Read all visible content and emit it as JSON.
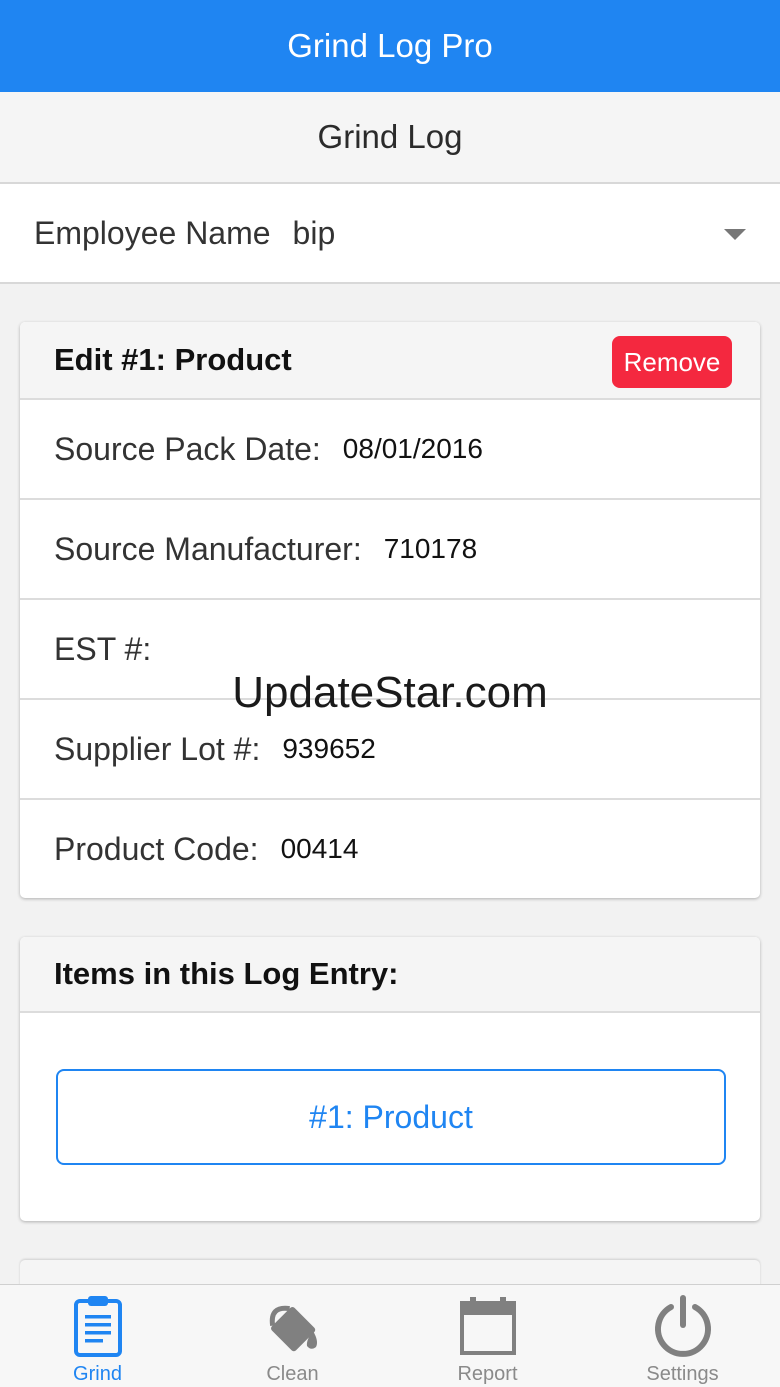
{
  "app_bar": {
    "title": "Grind Log Pro"
  },
  "page_header": {
    "title": "Grind Log"
  },
  "employee": {
    "label": "Employee Name",
    "value": "bip"
  },
  "edit_card": {
    "title": "Edit #1: Product",
    "remove_label": "Remove",
    "fields": [
      {
        "label": "Source Pack Date:",
        "value": "08/01/2016"
      },
      {
        "label": "Source Manufacturer:",
        "value": "710178"
      },
      {
        "label": "EST #:",
        "value": ""
      },
      {
        "label": "Supplier Lot #:",
        "value": "939652"
      },
      {
        "label": "Product Code:",
        "value": "00414"
      }
    ]
  },
  "items_card": {
    "title": "Items in this Log Entry:",
    "items": [
      {
        "label": "#1: Product"
      }
    ]
  },
  "watermark": "UpdateStar.com",
  "tabs": [
    {
      "label": "Grind",
      "icon": "clipboard-icon",
      "active": true
    },
    {
      "label": "Clean",
      "icon": "paint-bucket-icon",
      "active": false
    },
    {
      "label": "Report",
      "icon": "calendar-icon",
      "active": false
    },
    {
      "label": "Settings",
      "icon": "power-icon",
      "active": false
    }
  ],
  "colors": {
    "primary": "#1f85f2",
    "danger": "#f4283f",
    "header_bg": "#f5f5f5"
  }
}
